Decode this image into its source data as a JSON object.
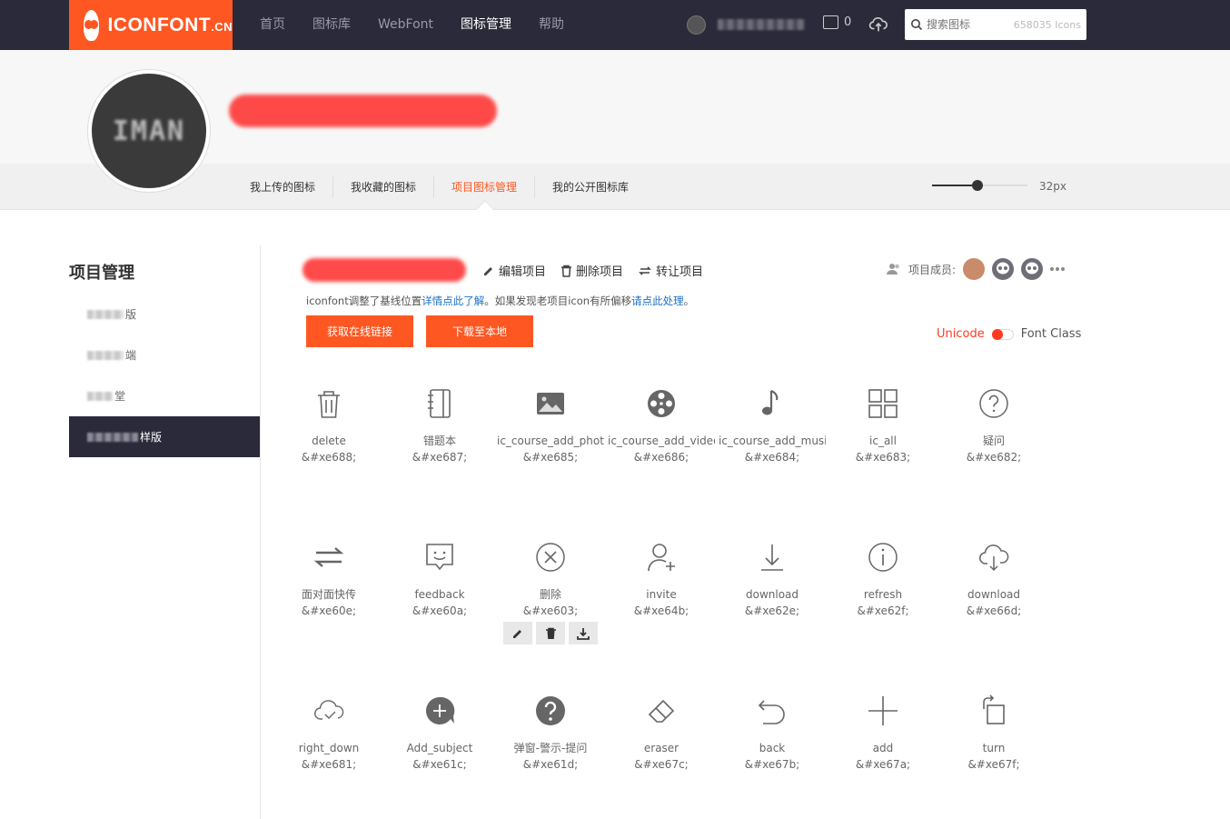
{
  "header": {
    "logo_text": "ICONFONT",
    "logo_suffix": ".CN",
    "nav": [
      "首页",
      "图标库",
      "WebFont",
      "图标管理",
      "帮助"
    ],
    "nav_active": 3,
    "cart_count": "0",
    "search_placeholder": "搜索图标",
    "search_count": "658035 Icons"
  },
  "profile": {
    "avatar_text": "IMAN",
    "tabs": [
      "我上传的图标",
      "我收藏的图标",
      "项目图标管理",
      "我的公开图标库"
    ],
    "active_tab": 2,
    "size_label": "32px",
    "size_value": 32
  },
  "sidebar": {
    "title": "项目管理",
    "items": [
      {
        "suffix": "版",
        "active": false
      },
      {
        "suffix": "端",
        "active": false
      },
      {
        "suffix": "堂",
        "active": false
      },
      {
        "suffix": "样版",
        "active": true
      }
    ]
  },
  "project": {
    "actions": [
      "编辑项目",
      "删除项目",
      "转让项目"
    ],
    "notice_prefix": "iconfont调整了基线位置",
    "notice_link1": "详情点此了解",
    "notice_middle": "。如果发现老项目icon有所偏移",
    "notice_link2": "请点此处理",
    "notice_suffix": "。",
    "btn_online": "获取在线链接",
    "btn_download": "下载至本地",
    "members_label": "项目成员:",
    "toggle_unicode": "Unicode",
    "toggle_fontclass": "Font Class"
  },
  "icons": [
    {
      "name": "delete",
      "code": "&#xe688;",
      "glyph": "trash-icon"
    },
    {
      "name": "错题本",
      "code": "&#xe687;",
      "glyph": "notebook-icon"
    },
    {
      "name": "ic_course_add_photo",
      "code": "&#xe685;",
      "glyph": "image-icon"
    },
    {
      "name": "ic_course_add_video",
      "code": "&#xe686;",
      "glyph": "film-reel-icon"
    },
    {
      "name": "ic_course_add_music",
      "code": "&#xe684;",
      "glyph": "music-note-icon"
    },
    {
      "name": "ic_all",
      "code": "&#xe683;",
      "glyph": "grid-icon"
    },
    {
      "name": "疑问",
      "code": "&#xe682;",
      "glyph": "question-circle-icon"
    },
    {
      "name": "面对面快传",
      "code": "&#xe60e;",
      "glyph": "swap-arrows-icon"
    },
    {
      "name": "feedback",
      "code": "&#xe60a;",
      "glyph": "feedback-icon"
    },
    {
      "name": "删除",
      "code": "&#xe603;",
      "glyph": "close-circle-icon"
    },
    {
      "name": "invite",
      "code": "&#xe64b;",
      "glyph": "user-add-icon"
    },
    {
      "name": "download",
      "code": "&#xe62e;",
      "glyph": "download-icon"
    },
    {
      "name": "refresh",
      "code": "&#xe62f;",
      "glyph": "info-circle-icon"
    },
    {
      "name": "download",
      "code": "&#xe66d;",
      "glyph": "cloud-download-icon"
    },
    {
      "name": "right_down",
      "code": "&#xe681;",
      "glyph": "cloud-icon"
    },
    {
      "name": "Add_subject",
      "code": "&#xe61c;",
      "glyph": "add-bubble-icon"
    },
    {
      "name": "弹窗-警示-提问",
      "code": "&#xe61d;",
      "glyph": "question-filled-icon"
    },
    {
      "name": "eraser",
      "code": "&#xe67c;",
      "glyph": "eraser-icon"
    },
    {
      "name": "back",
      "code": "&#xe67b;",
      "glyph": "back-arrow-icon"
    },
    {
      "name": "add",
      "code": "&#xe67a;",
      "glyph": "plus-icon"
    },
    {
      "name": "turn",
      "code": "&#xe67f;",
      "glyph": "rotate-icon"
    }
  ],
  "colors": {
    "accent": "#ff5722",
    "dark": "#2b2a3a",
    "icon": "#666666",
    "link": "#1c6fc7"
  }
}
